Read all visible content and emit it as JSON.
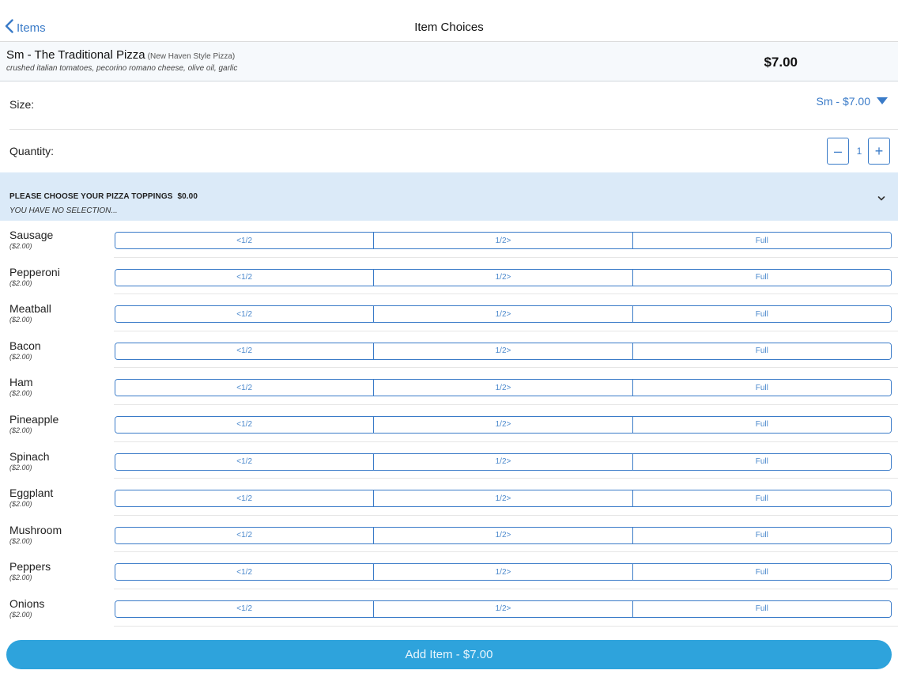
{
  "nav": {
    "back_label": "Items",
    "title": "Item Choices"
  },
  "item": {
    "name": "Sm - The Traditional Pizza",
    "style": "(New Haven Style Pizza)",
    "description": "crushed italian tomatoes, pecorino romano cheese, olive oil, garlic",
    "price": "$7.00"
  },
  "size": {
    "label": "Size:",
    "selected": "Sm - $7.00"
  },
  "quantity": {
    "label": "Quantity:",
    "minus": "–",
    "value": "1",
    "plus": "+"
  },
  "group": {
    "title": "PLEASE CHOOSE YOUR PIZZA TOPPINGS",
    "price": "$0.00",
    "selection_text": "YOU HAVE NO SELECTION..."
  },
  "segment_labels": [
    "<1/2",
    "1/2>",
    "Full"
  ],
  "toppings": [
    {
      "name": "Sausage",
      "price": "($2.00)"
    },
    {
      "name": "Pepperoni",
      "price": "($2.00)"
    },
    {
      "name": "Meatball",
      "price": "($2.00)"
    },
    {
      "name": "Bacon",
      "price": "($2.00)"
    },
    {
      "name": "Ham",
      "price": "($2.00)"
    },
    {
      "name": "Pineapple",
      "price": "($2.00)"
    },
    {
      "name": "Spinach",
      "price": "($2.00)"
    },
    {
      "name": "Eggplant",
      "price": "($2.00)"
    },
    {
      "name": "Mushroom",
      "price": "($2.00)"
    },
    {
      "name": "Peppers",
      "price": "($2.00)"
    },
    {
      "name": "Onions",
      "price": "($2.00)"
    }
  ],
  "footer": {
    "add_label": "Add Item - $7.00"
  },
  "colors": {
    "accent": "#3a7bc8",
    "group_bg": "#dbeaf8",
    "add_button": "#2ea3dc"
  },
  "icons": {
    "back": "chevron-left-icon",
    "size_dropdown": "caret-down-icon",
    "group_toggle": "chevron-down-icon"
  }
}
